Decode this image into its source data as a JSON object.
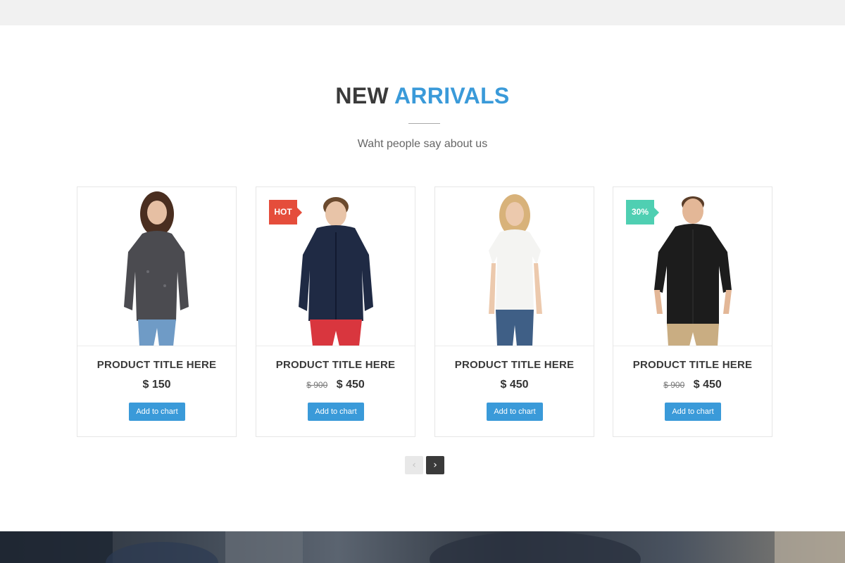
{
  "section": {
    "title_part1": "NEW",
    "title_part2": "ARRIVALS",
    "subtitle": "Waht people say about us"
  },
  "products": [
    {
      "title": "PRODUCT TITLE HERE",
      "old_price": "",
      "price": "$ 150",
      "button": "Add to chart",
      "badge": ""
    },
    {
      "title": "PRODUCT TITLE HERE",
      "old_price": "$ 900",
      "price": "$ 450",
      "button": "Add to chart",
      "badge": "HOT"
    },
    {
      "title": "PRODUCT TITLE HERE",
      "old_price": "",
      "price": "$ 450",
      "button": "Add to chart",
      "badge": ""
    },
    {
      "title": "PRODUCT TITLE HERE",
      "old_price": "$ 900",
      "price": "$ 450",
      "button": "Add to chart",
      "badge": "30%"
    }
  ],
  "pager": {
    "prev": "‹",
    "next": "›"
  },
  "colors": {
    "accent": "#3a9ad9",
    "hot_badge": "#e54d3b",
    "sale_badge": "#4fcfb2"
  }
}
